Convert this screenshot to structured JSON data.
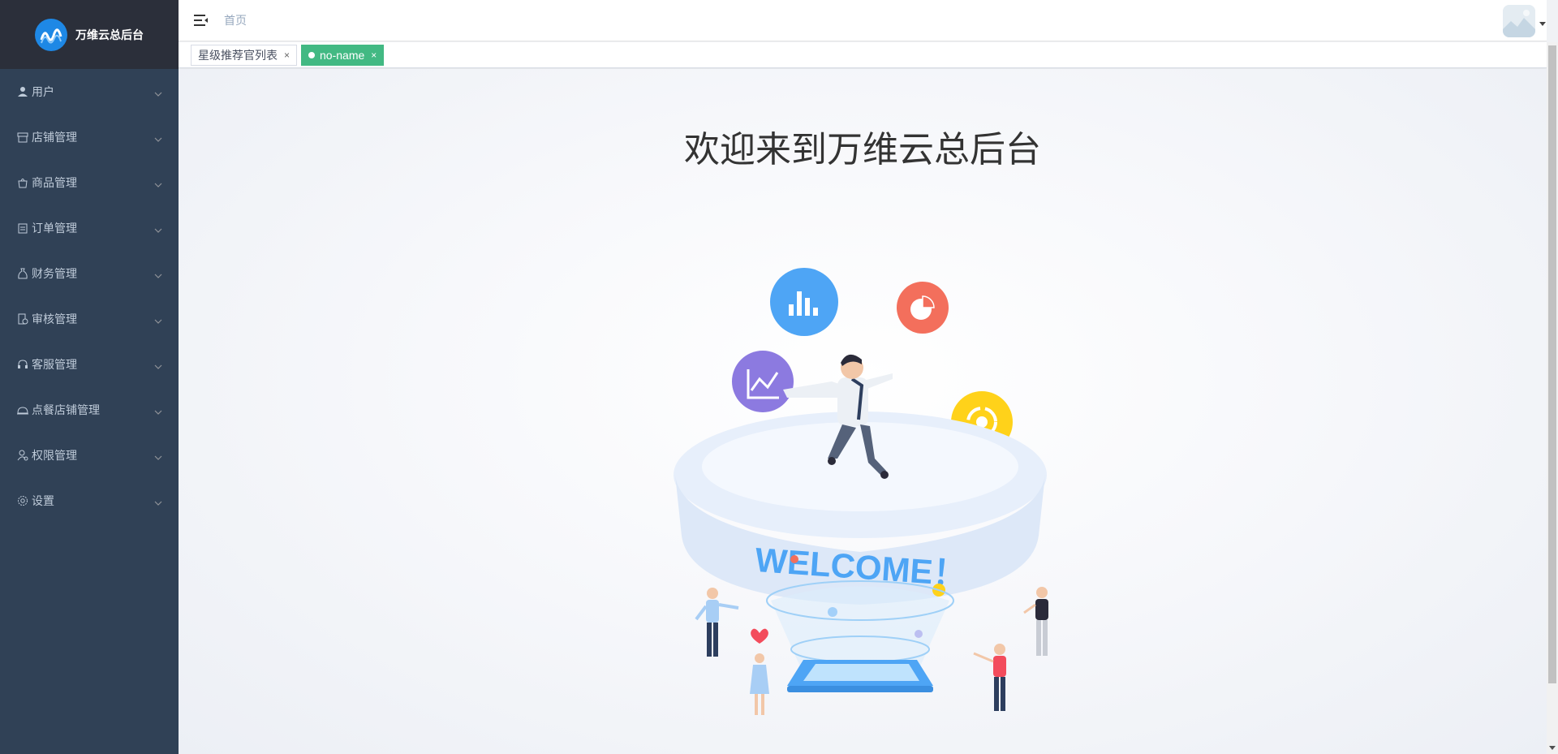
{
  "app": {
    "logo_title": "万维云总后台"
  },
  "sidebar": {
    "items": [
      {
        "label": "用户",
        "icon": "user-icon"
      },
      {
        "label": "店铺管理",
        "icon": "store-icon"
      },
      {
        "label": "商品管理",
        "icon": "shopping-bag-icon"
      },
      {
        "label": "订单管理",
        "icon": "clipboard-icon"
      },
      {
        "label": "财务管理",
        "icon": "money-bag-icon"
      },
      {
        "label": "审核管理",
        "icon": "audit-icon"
      },
      {
        "label": "客服管理",
        "icon": "headset-icon"
      },
      {
        "label": "点餐店铺管理",
        "icon": "food-cover-icon"
      },
      {
        "label": "权限管理",
        "icon": "user-permission-icon"
      },
      {
        "label": "设置",
        "icon": "gear-icon"
      }
    ]
  },
  "navbar": {
    "breadcrumb": "首页"
  },
  "tags": [
    {
      "label": "星级推荐官列表",
      "active": false
    },
    {
      "label": "no-name",
      "active": true
    }
  ],
  "tag_close_symbol": "×",
  "main": {
    "welcome_title": "欢迎来到万维云总后台",
    "banner_text": "WELCOME！"
  },
  "colors": {
    "sidebar_bg": "#304156",
    "active_tag": "#42b983",
    "chart_blue": "#4ea5f5",
    "chart_red": "#f36f5c",
    "chart_purple": "#8c7ae0",
    "chart_yellow": "#ffd21a"
  }
}
